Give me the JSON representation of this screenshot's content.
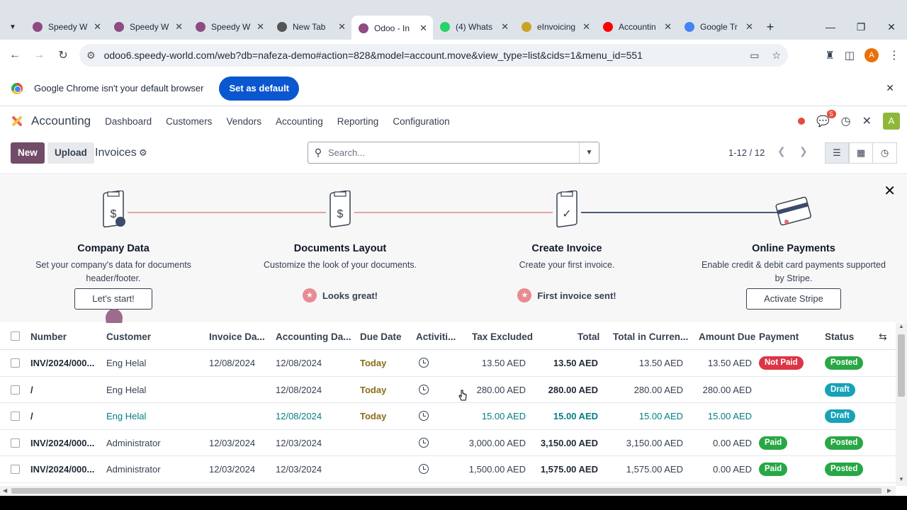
{
  "browser": {
    "tabs": [
      {
        "title": "Speedy W",
        "color": "#8e4b84"
      },
      {
        "title": "Speedy W",
        "color": "#8e4b84"
      },
      {
        "title": "Speedy W",
        "color": "#8e4b84"
      },
      {
        "title": "New Tab",
        "color": "#555555"
      },
      {
        "title": "Odoo - In",
        "color": "#8e4b84",
        "active": true
      },
      {
        "title": "(4) Whats",
        "color": "#25d366"
      },
      {
        "title": "eInvoicing",
        "color": "#c9a227"
      },
      {
        "title": "Accountin",
        "color": "#ff0000"
      },
      {
        "title": "Google Tr",
        "color": "#4285f4"
      }
    ],
    "url": "odoo6.speedy-world.com/web?db=nafeza-demo#action=828&model=account.move&view_type=list&cids=1&menu_id=551",
    "infobar_text": "Google Chrome isn't your default browser",
    "set_default_label": "Set as default",
    "profile_initial": "A"
  },
  "odoo": {
    "app_name": "Accounting",
    "menu": [
      "Dashboard",
      "Customers",
      "Vendors",
      "Accounting",
      "Reporting",
      "Configuration"
    ],
    "chat_count": "5",
    "user_initial": "A",
    "new_label": "New",
    "upload_label": "Upload",
    "breadcrumb": "Invoices",
    "search_placeholder": "Search...",
    "pager": "1-12 / 12"
  },
  "onboarding": {
    "steps": [
      {
        "title": "Company Data",
        "desc": "Set your company's data for documents header/footer.",
        "action": "Let's start!",
        "done": false
      },
      {
        "title": "Documents Layout",
        "desc": "Customize the look of your documents.",
        "action": "Looks great!",
        "done": true
      },
      {
        "title": "Create Invoice",
        "desc": "Create your first invoice.",
        "action": "First invoice sent!",
        "done": true
      },
      {
        "title": "Online Payments",
        "desc": "Enable credit & debit card payments supported by Stripe.",
        "action": "Activate Stripe",
        "done": false
      }
    ]
  },
  "table": {
    "headers": [
      "Number",
      "Customer",
      "Invoice Da...",
      "Accounting Da...",
      "Due Date",
      "Activiti...",
      "Tax Excluded",
      "Total",
      "Total in Curren...",
      "Amount Due",
      "Payment",
      "Status"
    ],
    "rows": [
      {
        "number": "INV/2024/000...",
        "customer": "Eng Helal",
        "invoice_date": "12/08/2024",
        "acc_date": "12/08/2024",
        "due": "Today",
        "tax_excl": "13.50 AED",
        "total": "13.50 AED",
        "total_cur": "13.50 AED",
        "amount_due": "13.50 AED",
        "payment": "Not Paid",
        "status": "Posted"
      },
      {
        "number": "/",
        "customer": "Eng Helal",
        "invoice_date": "",
        "acc_date": "12/08/2024",
        "due": "Today",
        "tax_excl": "280.00 AED",
        "total": "280.00 AED",
        "total_cur": "280.00 AED",
        "amount_due": "280.00 AED",
        "payment": "",
        "status": "Draft"
      },
      {
        "number": "/",
        "customer": "Eng Helal",
        "invoice_date": "",
        "acc_date": "12/08/2024",
        "due": "Today",
        "tax_excl": "15.00 AED",
        "total": "15.00 AED",
        "total_cur": "15.00 AED",
        "amount_due": "15.00 AED",
        "payment": "",
        "status": "Draft"
      },
      {
        "number": "INV/2024/000...",
        "customer": "Administrator",
        "invoice_date": "12/03/2024",
        "acc_date": "12/03/2024",
        "due": "",
        "tax_excl": "3,000.00 AED",
        "total": "3,150.00 AED",
        "total_cur": "3,150.00 AED",
        "amount_due": "0.00 AED",
        "payment": "Paid",
        "status": "Posted"
      },
      {
        "number": "INV/2024/000...",
        "customer": "Administrator",
        "invoice_date": "12/03/2024",
        "acc_date": "12/03/2024",
        "due": "",
        "tax_excl": "1,500.00 AED",
        "total": "1,575.00 AED",
        "total_cur": "1,575.00 AED",
        "amount_due": "0.00 AED",
        "payment": "Paid",
        "status": "Posted"
      }
    ]
  },
  "colors": {
    "primary": "#714b67",
    "posted": "#28a745",
    "draft": "#17a2b8",
    "not_paid": "#dc3545",
    "paid": "#28a745",
    "chrome_blue": "#0b57d0"
  }
}
